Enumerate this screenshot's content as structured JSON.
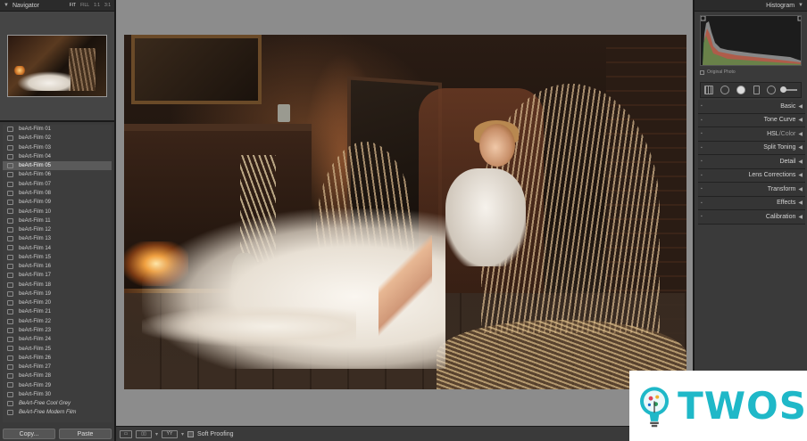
{
  "navigator": {
    "title": "Navigator",
    "zoom_options": [
      "FIT",
      "FILL",
      "1:1",
      "3:1"
    ]
  },
  "presets": [
    {
      "label": "beArt-Film 01"
    },
    {
      "label": "beArt-Film 02"
    },
    {
      "label": "beArt-Film 03"
    },
    {
      "label": "beArt-Film 04"
    },
    {
      "label": "beArt-Film 05",
      "selected": true
    },
    {
      "label": "beArt-Film 06"
    },
    {
      "label": "beArt-Film 07"
    },
    {
      "label": "beArt-Film 08"
    },
    {
      "label": "beArt-Film 09"
    },
    {
      "label": "beArt-Film 10"
    },
    {
      "label": "beArt-Film 11"
    },
    {
      "label": "beArt-Film 12"
    },
    {
      "label": "beArt-Film 13"
    },
    {
      "label": "beArt-Film 14"
    },
    {
      "label": "beArt-Film 15"
    },
    {
      "label": "beArt-Film 16"
    },
    {
      "label": "beArt-Film 17"
    },
    {
      "label": "beArt-Film 18"
    },
    {
      "label": "beArt-Film 19"
    },
    {
      "label": "beArt-Film 20"
    },
    {
      "label": "beArt-Film 21"
    },
    {
      "label": "beArt-Film 22"
    },
    {
      "label": "beArt-Film 23"
    },
    {
      "label": "beArt-Film 24"
    },
    {
      "label": "beArt-Film 25"
    },
    {
      "label": "beArt-Film 26"
    },
    {
      "label": "beArt-Film 27"
    },
    {
      "label": "beArt-Film 28"
    },
    {
      "label": "beArt-Film 29"
    },
    {
      "label": "beArt-Film 30"
    },
    {
      "label": "BeArt-Free Cool Grey",
      "italic": true
    },
    {
      "label": "BeArt-Free Modern Film",
      "italic": true
    }
  ],
  "buttons": {
    "copy": "Copy...",
    "paste": "Paste"
  },
  "toolbar": {
    "soft_proofing": "Soft Proofing"
  },
  "histogram": {
    "title": "Histogram",
    "original_photo": "Original Photo"
  },
  "develop_panels": [
    {
      "label": "Basic"
    },
    {
      "label": "Tone Curve"
    },
    {
      "label": "HSL",
      "suffix": "Color"
    },
    {
      "label": "Split Toning"
    },
    {
      "label": "Detail"
    },
    {
      "label": "Lens Corrections"
    },
    {
      "label": "Transform"
    },
    {
      "label": "Effects"
    },
    {
      "label": "Calibration"
    }
  ],
  "logo": {
    "text": "TWOS",
    "color": "#1fb8c8"
  },
  "colors": {
    "panel_bg": "#3a3a3a",
    "canvas_bg": "#8c8c8c",
    "selected_row": "#5a5a5a"
  }
}
